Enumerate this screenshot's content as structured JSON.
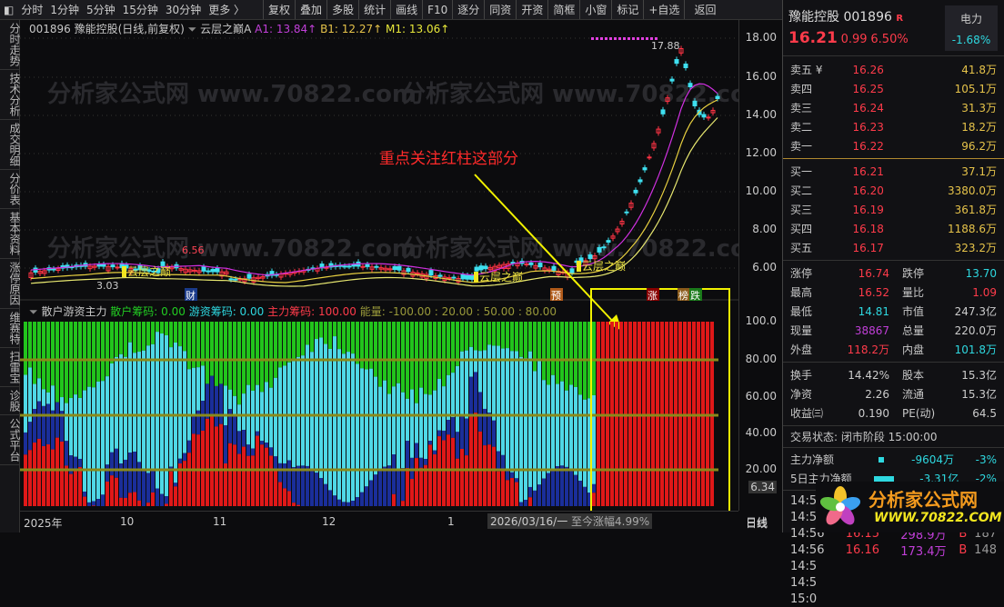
{
  "toolbar": {
    "periods": [
      "分时",
      "1分钟",
      "5分钟",
      "15分钟",
      "30分钟",
      "更多 〉"
    ],
    "buttons": [
      "复权",
      "叠加",
      "多股",
      "统计",
      "画线",
      "F10",
      "逐分",
      "同资",
      "开资",
      "简框",
      "小窗",
      "标记",
      "+自选"
    ],
    "back": "返回"
  },
  "leftnav": [
    "分时走势",
    "技术分析",
    "成交明细",
    "分价表",
    "基本资料",
    "涨停原因",
    "维赛特",
    "扫雷宝",
    "诊股",
    "公式平台"
  ],
  "chart": {
    "title": "001896 豫能控股(日线,前复权)",
    "indicator": "云层之巅A",
    "a1": "A1: 13.84↑",
    "b1": "B1: 12.27↑",
    "m1": "M1: 13.06↑",
    "high_label": "17.88",
    "low_label": "3.03",
    "peak_label": "6.56",
    "cloud_label": "云层之巅",
    "annotation": "重点关注红柱这部分",
    "badges": {
      "cai": "财",
      "yu": "预",
      "zhang": "涨",
      "bang": "榜",
      "die": "跌"
    },
    "price_ticks": [
      "18.00",
      "16.00",
      "14.00",
      "12.00",
      "10.00",
      "8.00",
      "6.00"
    ],
    "watermark": "分析家公式网 www.70822.com"
  },
  "sub": {
    "name": "散户游资主力",
    "retail": "散户筹码: 0.00",
    "hot": "游资筹码: 0.00",
    "main": "主力筹码: 100.00",
    "energy": "能量: -100.00 : 20.00 : 50.00 : 80.00",
    "ticks": [
      "100.0",
      "80.00",
      "60.00",
      "40.00",
      "20.00",
      "6.34"
    ],
    "colors": {
      "green": "#22c41c",
      "cyan": "#4fd8e6",
      "blue": "#1a2e9a",
      "red": "#e01818"
    }
  },
  "xaxis": {
    "labels": [
      "2025年",
      "10",
      "11",
      "12",
      "1"
    ],
    "cursor": "2026/03/16/一",
    "change": "至今涨幅4.99%",
    "period": "日线"
  },
  "quote": {
    "name": "豫能控股",
    "code": "001896",
    "r": "R",
    "price": "16.21",
    "change": "0.99",
    "pct": "6.50%",
    "power_label": "电力",
    "power_pct": "-1.68%",
    "asks": [
      [
        "卖五 ¥",
        "16.26",
        "41.8万"
      ],
      [
        "卖四",
        "16.25",
        "105.1万"
      ],
      [
        "卖三",
        "16.24",
        "31.3万"
      ],
      [
        "卖二",
        "16.23",
        "18.2万"
      ],
      [
        "卖一",
        "16.22",
        "96.2万"
      ]
    ],
    "bids": [
      [
        "买一",
        "16.21",
        "37.1万"
      ],
      [
        "买二",
        "16.20",
        "3380.0万"
      ],
      [
        "买三",
        "16.19",
        "361.8万"
      ],
      [
        "买四",
        "16.18",
        "1188.6万"
      ],
      [
        "买五",
        "16.17",
        "323.2万"
      ]
    ],
    "stats": [
      [
        "涨停",
        "16.74",
        "跌停",
        "13.70"
      ],
      [
        "最高",
        "16.52",
        "量比",
        "1.09"
      ],
      [
        "最低",
        "14.81",
        "市值",
        "247.3亿"
      ],
      [
        "现量",
        "38867",
        "总量",
        "220.0万"
      ],
      [
        "外盘",
        "118.2万",
        "内盘",
        "101.8万"
      ]
    ],
    "stats2": [
      [
        "换手",
        "14.42%",
        "股本",
        "15.3亿"
      ],
      [
        "净资",
        "2.26",
        "流通",
        "15.3亿"
      ],
      [
        "收益㈢",
        "0.190",
        "PE(动)",
        "64.5"
      ]
    ],
    "status": "交易状态: 闭市阶段 15:00:00",
    "flow": [
      [
        "主力净额",
        "-9604万",
        "-3%"
      ],
      [
        "5日主力净额",
        "-3.31亿",
        "-2%"
      ]
    ],
    "ticks": [
      [
        "14:56",
        "16.11",
        "248.9万",
        "B",
        "190"
      ],
      [
        "14:56",
        "16.13",
        "146.8万",
        "B",
        "109"
      ],
      [
        "14:56",
        "16.15",
        "298.9万",
        "B",
        "187"
      ],
      [
        "14:56",
        "16.16",
        "173.4万",
        "B",
        "148"
      ],
      [
        "14:5",
        "",
        "",
        "",
        ""
      ],
      [
        "14:5",
        "",
        "",
        "",
        ""
      ],
      [
        "15:0",
        "",
        "",
        "",
        ""
      ]
    ],
    "logo_text": "分析家公式网",
    "logo_url": "WWW.70822.COM"
  }
}
